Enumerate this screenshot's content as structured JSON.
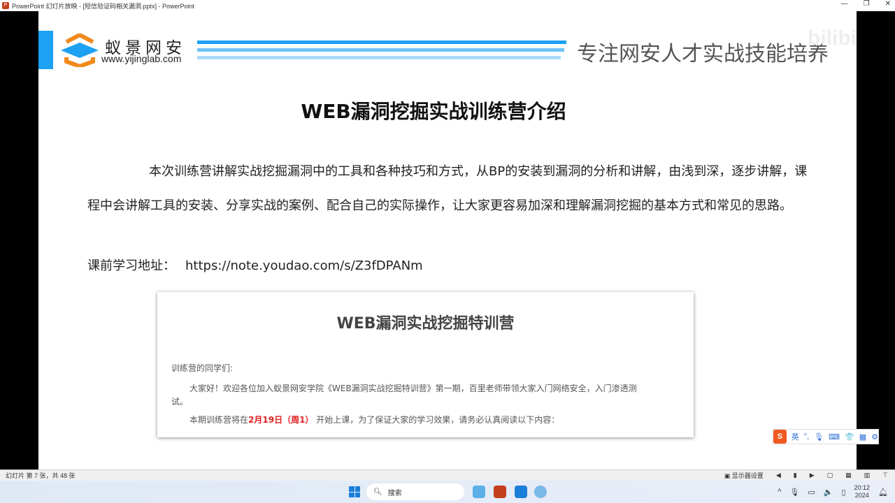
{
  "window": {
    "title": "PowerPoint 幻灯片放映 - [短信验证码相关漏洞.pptx] - PowerPoint"
  },
  "slide": {
    "brand": "蚁景网安",
    "site": "www.yijinglab.com",
    "slogan": "专注网安人才实战技能培养",
    "watermark": "bilibili",
    "title": "WEB漏洞挖掘实战训练营介绍",
    "paragraph": "本次训练营讲解实战挖掘漏洞中的工具和各种技巧和方式，从BP的安装到漏洞的分析和讲解，由浅到深，逐步讲解，课程中会讲解工具的安装、分享实战的案例、配合自己的实际操作，让大家更容易加深和理解漏洞挖掘的基本方式和常见的思路。",
    "url_label": "课前学习地址：",
    "url": "https://note.youdao.com/s/Z3fDPANm",
    "doc": {
      "title": "WEB漏洞实战挖掘特训营",
      "greeting": "训练营的同学们:",
      "line1": "大家好！欢迎各位加入蚁景网安学院《WEB漏洞实战挖掘特训营》第一期，百里老师带领大家入门网络安全，入门渗透测",
      "line1b": "试。",
      "line2a": "本期训练营将在",
      "line2date": "2月19日（周1）",
      "line2b": " 开始上课，为了保证大家的学习效果，请务必认真阅读以下内容："
    }
  },
  "ime": {
    "mode": "英",
    "punct": "°,"
  },
  "status": {
    "slide_info": "幻灯片 第 7 张，共 48 张",
    "display_settings": "显示器设置"
  },
  "taskbar": {
    "search_placeholder": "搜索",
    "time": "20:12",
    "year": "2024"
  },
  "colors": {
    "accent": "#1da1f2",
    "red": "#e02020"
  }
}
